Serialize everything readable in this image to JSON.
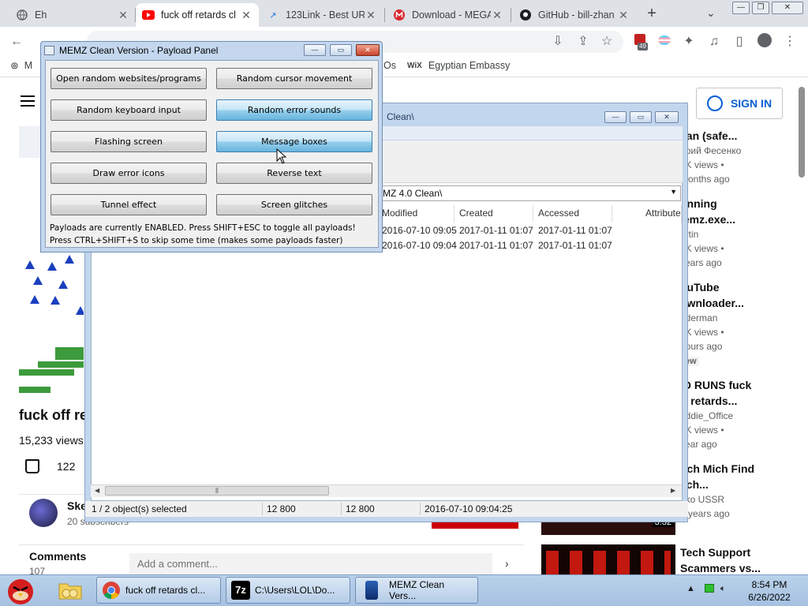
{
  "browser": {
    "tabs": [
      {
        "title": "Eh",
        "icon": "globe-icon"
      },
      {
        "title": "fuck off retards cl",
        "icon": "youtube-icon",
        "active": true
      },
      {
        "title": "123Link - Best UR",
        "icon": "link-icon"
      },
      {
        "title": "Download - MEGA",
        "icon": "mega-icon"
      },
      {
        "title": "GitHub - bill-zhan",
        "icon": "github-icon"
      }
    ],
    "address": "…",
    "extension_badge": "49",
    "bookmarks": [
      {
        "label": "M",
        "icon": "globe-icon"
      },
      {
        "label": "Os",
        "icon": ""
      },
      {
        "label": "Egyptian Embassy",
        "icon": "wix-icon",
        "icon_text": "WiX"
      }
    ]
  },
  "youtube": {
    "signin_label": "SIGN IN",
    "video_title": "fuck off re",
    "views": "15,233 views",
    "likes": "122",
    "channel_name": "Ske",
    "channel_subs": "20 subscribers",
    "comments_heading": "Comments",
    "comments_count": "107",
    "add_comment_placeholder": "Add a comment...",
    "recommendations": [
      {
        "title_lines": [
          "ean (safe..."
        ],
        "author": "ирий Фесенко",
        "views": "3K views •",
        "age": "months ago"
      },
      {
        "title_lines": [
          "unning",
          "lemz.exe..."
        ],
        "author": "artin",
        "views": "4K views •",
        "age": "years ago"
      },
      {
        "title_lines": [
          "ouTube",
          "ownloader..."
        ],
        "author": "nderman",
        "views": "8K views •",
        "age": "hours ago",
        "badge": "lew"
      },
      {
        "title_lines": [
          "ID RUNS fuck",
          "ff retards..."
        ],
        "author": "eddie_Office",
        "views": "9K views •",
        "age": "year ago"
      },
      {
        "title_lines": [
          "uch Mich Find",
          "lich..."
        ],
        "author": "eko USSR",
        "views": "",
        "age": "2 years ago",
        "duration": "3:32"
      },
      {
        "title_lines": [
          "Tech Support",
          "Scammers vs..."
        ],
        "author": "",
        "views": "",
        "age": ""
      }
    ]
  },
  "explorer": {
    "title": "Clean\\",
    "address": "MZ 4.0 Clean\\",
    "columns": [
      "Modified",
      "Created",
      "Accessed",
      "Attribute"
    ],
    "rows": [
      [
        "2016-07-10 09:05",
        "2017-01-11 01:07",
        "2017-01-11 01:07"
      ],
      [
        "2016-07-10 09:04",
        "2017-01-11 01:07",
        "2017-01-11 01:07"
      ]
    ],
    "status": {
      "selection": "1 / 2 object(s) selected",
      "size1": "12 800",
      "size2": "12 800",
      "date": "2016-07-10 09:04:25"
    }
  },
  "memz": {
    "title": "MEMZ Clean Version - Payload Panel",
    "buttons": [
      {
        "label": "Open random websites/programs",
        "on": false
      },
      {
        "label": "Random cursor movement",
        "on": false
      },
      {
        "label": "Random keyboard input",
        "on": false
      },
      {
        "label": "Random error sounds",
        "on": true
      },
      {
        "label": "Flashing screen",
        "on": false
      },
      {
        "label": "Message boxes",
        "on": true
      },
      {
        "label": "Draw error icons",
        "on": false
      },
      {
        "label": "Reverse text",
        "on": false
      },
      {
        "label": "Tunnel effect",
        "on": false
      },
      {
        "label": "Screen glitches",
        "on": false
      }
    ],
    "info_line1": "Payloads are currently ENABLED. Press SHIFT+ESC to toggle all payloads!",
    "info_line2": "Press CTRL+SHIFT+S to skip some time (makes some payloads faster)"
  },
  "taskbar": {
    "apps": [
      {
        "label": "fuck off retards cl...",
        "icon": "chrome-icon"
      },
      {
        "label": "C:\\Users\\LOL\\Do...",
        "icon": "7zip-icon",
        "icon_text": "7z"
      },
      {
        "label": "MEMZ Clean Vers...",
        "icon": "memz-icon"
      }
    ],
    "time": "8:54 PM",
    "date": "6/26/2022"
  },
  "colors": {
    "youtube_blue": "#065fd4",
    "button_active": "#98d1ef",
    "taskbar": "#b9d1ea"
  }
}
